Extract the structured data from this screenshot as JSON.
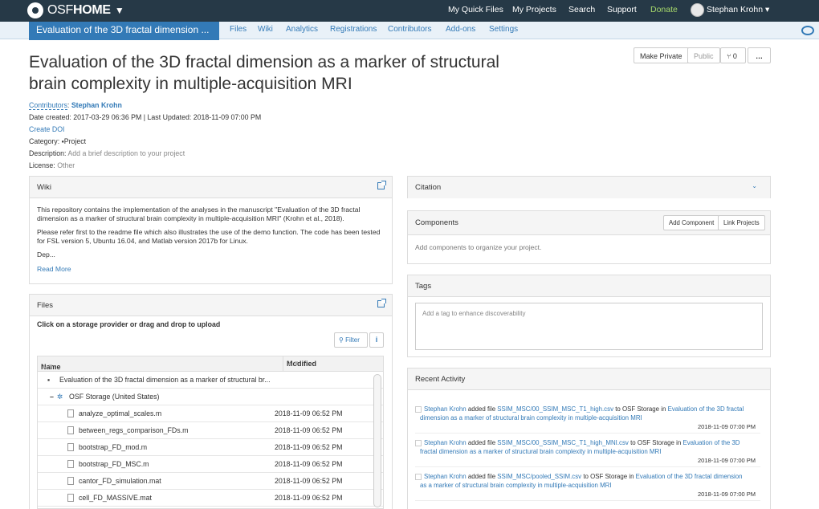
{
  "nav": {
    "logo_light": "OSF",
    "logo_bold": "HOME",
    "quick_files": "My Quick Files",
    "my_projects": "My Projects",
    "search": "Search",
    "support": "Support",
    "donate": "Donate",
    "user": "Stephan Krohn"
  },
  "subnav": {
    "project_tab": "Evaluation of the 3D fractal dimension ...",
    "items": [
      "Files",
      "Wiki",
      "Analytics",
      "Registrations",
      "Contributors",
      "Add-ons",
      "Settings"
    ]
  },
  "project": {
    "title_line1": "Evaluation of the 3D fractal dimension as a marker of structural",
    "title_line2": "brain complexity in multiple-acquisition MRI",
    "make_private": "Make Private",
    "public": "Public",
    "forks": "0",
    "more": "…",
    "contributors_label": "Contributors",
    "contributor": "Stephan Krohn",
    "date_line": "Date created: 2017-03-29 06:36 PM | Last Updated: 2018-11-09 07:00 PM",
    "create_doi": "Create DOI",
    "category_label": "Category:",
    "category": "Project",
    "description_label": "Description:",
    "description_placeholder": "Add a brief description to your project",
    "license_label": "License:",
    "license": "Other"
  },
  "wiki": {
    "title": "Wiki",
    "para1": "This repository contains the implementation of the analyses in the manuscript \"Evaluation of the 3D fractal dimension as a marker of structural brain complexity in multiple-acquisition MRI\" (Krohn et al., 2018).",
    "para2": "Please refer first to the readme file which also illustrates the use of the demo function. The code has been tested for FSL version 5, Ubuntu 16.04, and Matlab version 2017b for Linux.",
    "para3": "Dep...",
    "read_more": "Read More"
  },
  "files": {
    "title": "Files",
    "hint": "Click on a storage provider or drag and drop to upload",
    "filter": "Filter",
    "info": "i",
    "col_name": "Name",
    "col_modified": "Modified",
    "project_row": "Evaluation of the 3D fractal dimension as a marker of structural br...",
    "storage_row": "OSF Storage (United States)",
    "rows": [
      {
        "name": "analyze_optimal_scales.m",
        "modified": "2018-11-09 06:52 PM"
      },
      {
        "name": "between_regs_comparison_FDs.m",
        "modified": "2018-11-09 06:52 PM"
      },
      {
        "name": "bootstrap_FD_mod.m",
        "modified": "2018-11-09 06:52 PM"
      },
      {
        "name": "bootstrap_FD_MSC.m",
        "modified": "2018-11-09 06:52 PM"
      },
      {
        "name": "cantor_FD_simulation.mat",
        "modified": "2018-11-09 06:52 PM"
      },
      {
        "name": "cell_FD_MASSIVE.mat",
        "modified": "2018-11-09 06:52 PM"
      }
    ]
  },
  "citation": {
    "title": "Citation"
  },
  "components": {
    "title": "Components",
    "add_component": "Add Component",
    "link_projects": "Link Projects",
    "empty": "Add components to organize your project."
  },
  "tags": {
    "title": "Tags",
    "placeholder": "Add a tag to enhance discoverability"
  },
  "activity": {
    "title": "Recent Activity",
    "items": [
      {
        "user": "Stephan Krohn",
        "verb": "added file",
        "file": "SSIM_MSC/00_SSIM_MSC_T1_high.csv",
        "to": "to OSF Storage in",
        "project1": "Evaluation of the 3D fractal",
        "project2": "dimension as a marker of structural brain complexity in multiple-acquisition MRI",
        "time": "2018-11-09 07:00 PM"
      },
      {
        "user": "Stephan Krohn",
        "verb": "added file",
        "file": "SSIM_MSC/00_SSIM_MSC_T1_high_MNI.csv",
        "to": "to OSF Storage in",
        "project1": "Evaluation of the 3D",
        "project2": "fractal dimension as a marker of structural brain complexity in multiple-acquisition MRI",
        "time": "2018-11-09 07:00 PM"
      },
      {
        "user": "Stephan Krohn",
        "verb": "added file",
        "file": "SSIM_MSC/pooled_SSIM.csv",
        "to": "to OSF Storage in",
        "project1": "Evaluation of the 3D fractal dimension",
        "project2": "as a marker of structural brain complexity in multiple-acquisition MRI",
        "time": "2018-11-09 07:00 PM"
      }
    ]
  }
}
